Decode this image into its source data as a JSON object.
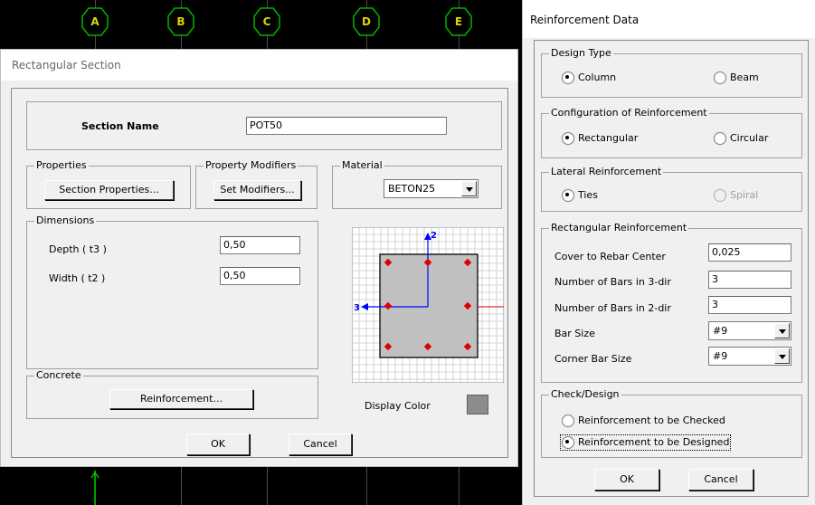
{
  "background": {
    "grid_bubbles": [
      "A",
      "B",
      "C",
      "D",
      "E"
    ]
  },
  "rect_section": {
    "title": "Rectangular Section",
    "section_name_label": "Section Name",
    "section_name_value": "POT50",
    "properties": {
      "legend": "Properties",
      "button": "Section Properties..."
    },
    "modifiers": {
      "legend": "Property Modifiers",
      "button": "Set Modifiers..."
    },
    "material": {
      "legend": "Material",
      "value": "BETON25"
    },
    "dimensions": {
      "legend": "Dimensions",
      "depth_label": "Depth  ( t3 )",
      "depth_value": "0,50",
      "width_label": "Width  ( t2 )",
      "width_value": "0,50"
    },
    "preview": {
      "axis_2": "2",
      "axis_3": "3"
    },
    "concrete": {
      "legend": "Concrete",
      "button": "Reinforcement..."
    },
    "display_color_label": "Display Color",
    "display_color": "#8c8c8c",
    "ok": "OK",
    "cancel": "Cancel"
  },
  "reinforcement": {
    "title": "Reinforcement Data",
    "design_type": {
      "legend": "Design Type",
      "option_column": "Column",
      "option_beam": "Beam",
      "selected": "Column"
    },
    "configuration": {
      "legend": "Configuration of Reinforcement",
      "option_rect": "Rectangular",
      "option_circ": "Circular",
      "selected": "Rectangular"
    },
    "lateral": {
      "legend": "Lateral Reinforcement",
      "option_ties": "Ties",
      "option_spiral": "Spiral",
      "selected": "Ties"
    },
    "rect_reinf": {
      "legend": "Rectangular Reinforcement",
      "cover_label": "Cover to Rebar Center",
      "cover_value": "0,025",
      "bars3_label": "Number of Bars in 3-dir",
      "bars3_value": "3",
      "bars2_label": "Number of Bars in 2-dir",
      "bars2_value": "3",
      "barsize_label": "Bar Size",
      "barsize_value": "#9",
      "cornersize_label": "Corner Bar Size",
      "cornersize_value": "#9"
    },
    "check_design": {
      "legend": "Check/Design",
      "option_checked": "Reinforcement to be Checked",
      "option_designed": "Reinforcement to be Designed",
      "selected": "Reinforcement to be Designed"
    },
    "ok": "OK",
    "cancel": "Cancel"
  },
  "colors": {
    "bubble_text": "#d7d700",
    "bubble_outline": "#00b400",
    "section_fill": "#c0c0c0",
    "rebar": "#e00000",
    "local_axis": "#0000ff"
  }
}
